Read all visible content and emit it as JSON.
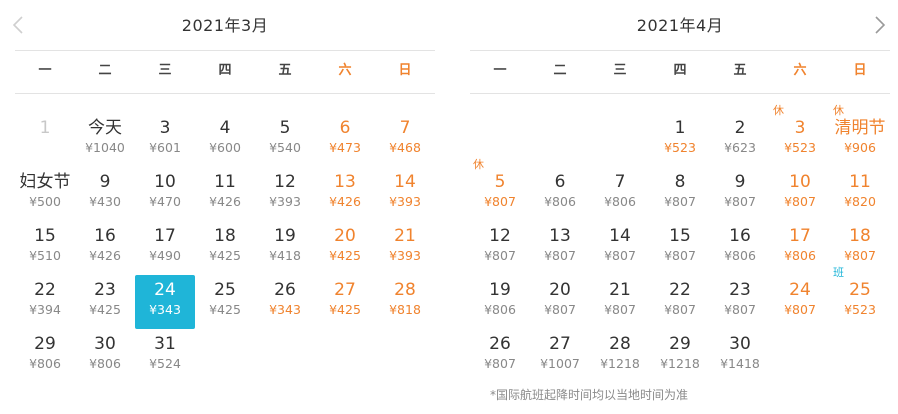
{
  "nav": {
    "prev_icon": "chevron-left-icon",
    "next_icon": "chevron-right-icon"
  },
  "colors": {
    "accent": "#1fb5d8",
    "weekend": "#f0832e",
    "text": "#333333",
    "price": "#888888"
  },
  "weekdays": [
    {
      "label": "一",
      "weekend": false
    },
    {
      "label": "二",
      "weekend": false
    },
    {
      "label": "三",
      "weekend": false
    },
    {
      "label": "四",
      "weekend": false
    },
    {
      "label": "五",
      "weekend": false
    },
    {
      "label": "六",
      "weekend": true
    },
    {
      "label": "日",
      "weekend": true
    }
  ],
  "months": [
    {
      "title": "2021年3月",
      "rows": [
        [
          {
            "day": "1",
            "price": "",
            "disabled": true
          },
          {
            "day": "今天",
            "price": "¥1040"
          },
          {
            "day": "3",
            "price": "¥601"
          },
          {
            "day": "4",
            "price": "¥600"
          },
          {
            "day": "5",
            "price": "¥540"
          },
          {
            "day": "6",
            "price": "¥473",
            "weekend": true
          },
          {
            "day": "7",
            "price": "¥468",
            "weekend": true
          }
        ],
        [
          {
            "day": "妇女节",
            "price": "¥500"
          },
          {
            "day": "9",
            "price": "¥430"
          },
          {
            "day": "10",
            "price": "¥470"
          },
          {
            "day": "11",
            "price": "¥426"
          },
          {
            "day": "12",
            "price": "¥393"
          },
          {
            "day": "13",
            "price": "¥426",
            "weekend": true
          },
          {
            "day": "14",
            "price": "¥393",
            "weekend": true
          }
        ],
        [
          {
            "day": "15",
            "price": "¥510"
          },
          {
            "day": "16",
            "price": "¥426"
          },
          {
            "day": "17",
            "price": "¥490"
          },
          {
            "day": "18",
            "price": "¥425"
          },
          {
            "day": "19",
            "price": "¥418"
          },
          {
            "day": "20",
            "price": "¥425",
            "weekend": true
          },
          {
            "day": "21",
            "price": "¥393",
            "weekend": true
          }
        ],
        [
          {
            "day": "22",
            "price": "¥394"
          },
          {
            "day": "23",
            "price": "¥425"
          },
          {
            "day": "24",
            "price": "¥343",
            "selected": true
          },
          {
            "day": "25",
            "price": "¥425"
          },
          {
            "day": "26",
            "price": "¥343",
            "price_orange": true
          },
          {
            "day": "27",
            "price": "¥425",
            "weekend": true
          },
          {
            "day": "28",
            "price": "¥818",
            "weekend": true
          }
        ],
        [
          {
            "day": "29",
            "price": "¥806"
          },
          {
            "day": "30",
            "price": "¥806"
          },
          {
            "day": "31",
            "price": "¥524"
          }
        ]
      ]
    },
    {
      "title": "2021年4月",
      "rows": [
        [
          null,
          null,
          null,
          {
            "day": "1",
            "price": "¥523",
            "price_orange": true
          },
          {
            "day": "2",
            "price": "¥623"
          },
          {
            "day": "3",
            "price": "¥523",
            "weekend": true,
            "price_orange": true,
            "badge": "休"
          },
          {
            "day": "清明节",
            "price": "¥906",
            "weekend": true,
            "badge": "休"
          }
        ],
        [
          {
            "day": "5",
            "price": "¥807",
            "weekend": true,
            "badge": "休"
          },
          {
            "day": "6",
            "price": "¥806"
          },
          {
            "day": "7",
            "price": "¥806"
          },
          {
            "day": "8",
            "price": "¥807"
          },
          {
            "day": "9",
            "price": "¥807"
          },
          {
            "day": "10",
            "price": "¥807",
            "weekend": true
          },
          {
            "day": "11",
            "price": "¥820",
            "weekend": true
          }
        ],
        [
          {
            "day": "12",
            "price": "¥807"
          },
          {
            "day": "13",
            "price": "¥807"
          },
          {
            "day": "14",
            "price": "¥807"
          },
          {
            "day": "15",
            "price": "¥807"
          },
          {
            "day": "16",
            "price": "¥806"
          },
          {
            "day": "17",
            "price": "¥806",
            "weekend": true
          },
          {
            "day": "18",
            "price": "¥807",
            "weekend": true
          }
        ],
        [
          {
            "day": "19",
            "price": "¥806"
          },
          {
            "day": "20",
            "price": "¥807"
          },
          {
            "day": "21",
            "price": "¥807"
          },
          {
            "day": "22",
            "price": "¥807"
          },
          {
            "day": "23",
            "price": "¥807"
          },
          {
            "day": "24",
            "price": "¥807",
            "weekend": true
          },
          {
            "day": "25",
            "price": "¥523",
            "weekend": true,
            "price_orange": true,
            "badge": "班",
            "badge_work": true
          }
        ],
        [
          {
            "day": "26",
            "price": "¥807"
          },
          {
            "day": "27",
            "price": "¥1007"
          },
          {
            "day": "28",
            "price": "¥1218"
          },
          {
            "day": "29",
            "price": "¥1218"
          },
          {
            "day": "30",
            "price": "¥1418"
          }
        ]
      ]
    }
  ],
  "footnote": "*国际航班起降时间均以当地时间为准"
}
